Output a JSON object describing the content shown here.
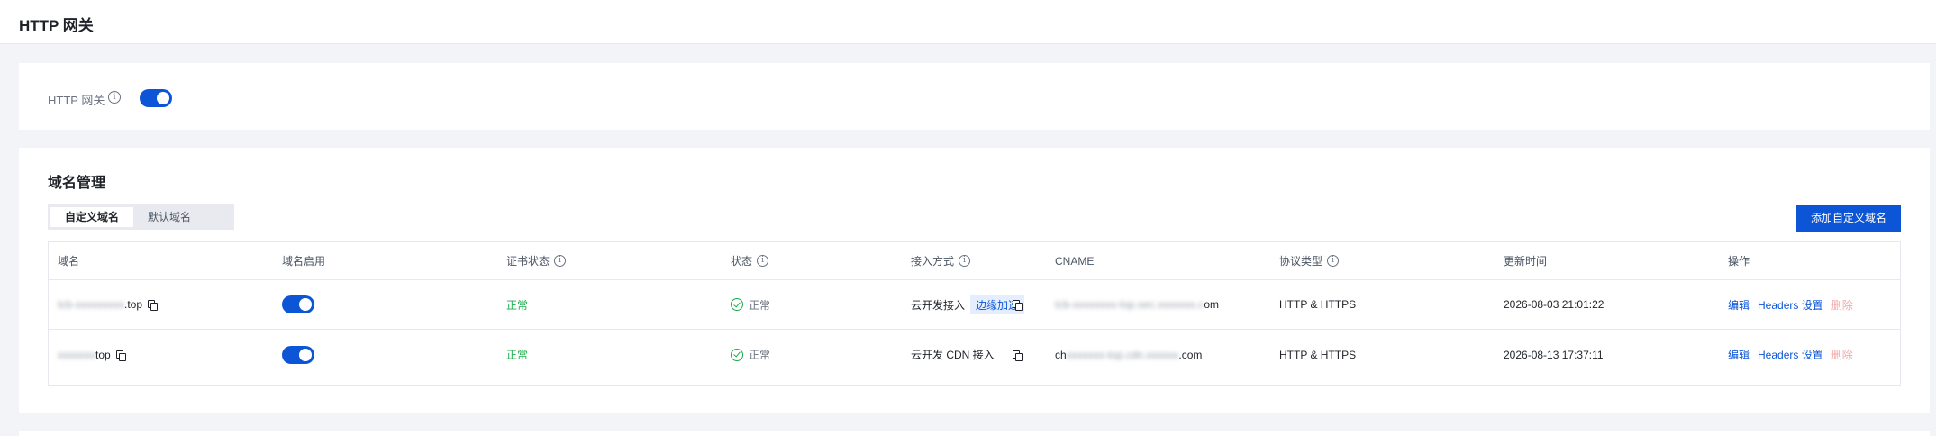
{
  "header": {
    "title": "HTTP 网关"
  },
  "gateway": {
    "label": "HTTP 网关",
    "enabled": true
  },
  "domain_section": {
    "title": "域名管理",
    "tabs": [
      {
        "label": "自定义域名",
        "active": true
      },
      {
        "label": "默认域名",
        "active": false
      }
    ],
    "add_button": "添加自定义域名",
    "columns": [
      "域名",
      "域名启用",
      "证书状态",
      "状态",
      "接入方式",
      "CNAME",
      "协议类型",
      "更新时间",
      "操作"
    ],
    "rows": [
      {
        "domain_prefix": "tcb-xxxxxxxxx",
        "domain_suffix": ".top",
        "enabled": true,
        "cert_status": "正常",
        "status": "正常",
        "access_mode": "云开发接入",
        "access_tag": "边缘加速",
        "cname_prefix": "",
        "cname_blur": "tcb-xxxxxxxx-top.sec.xxxxxxx.c",
        "cname_suffix": "om",
        "protocol": "HTTP & HTTPS",
        "updated": "2026-08-03 21:01:22",
        "actions": {
          "edit": "编辑",
          "headers": "Headers 设置",
          "delete": "删除"
        }
      },
      {
        "domain_prefix": "xxxxxxx",
        "domain_suffix": "top",
        "enabled": true,
        "cert_status": "正常",
        "status": "正常",
        "access_mode": "云开发 CDN 接入",
        "access_tag": "",
        "cname_prefix": "ch",
        "cname_blur": "xxxxxxx-top.cdn.xxxxxx",
        "cname_suffix": ".com",
        "protocol": "HTTP & HTTPS",
        "updated": "2026-08-13 17:37:11",
        "actions": {
          "edit": "编辑",
          "headers": "Headers 设置",
          "delete": "删除"
        }
      }
    ]
  },
  "colors": {
    "primary": "#0b55d6",
    "success": "#1aad4b",
    "danger_disabled": "#f3a7a7"
  }
}
